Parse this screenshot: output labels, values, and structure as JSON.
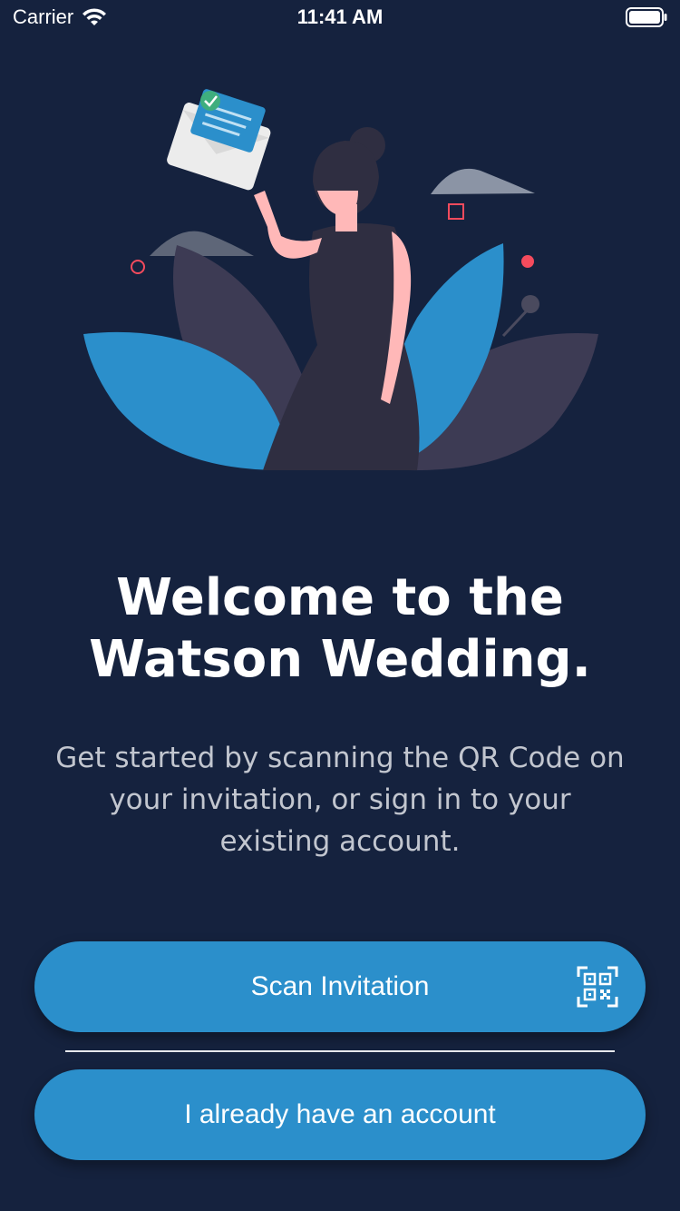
{
  "status_bar": {
    "carrier": "Carrier",
    "time": "11:41 AM",
    "wifi_icon": "wifi-icon",
    "battery_icon": "battery-icon"
  },
  "illustration": {
    "icon": "woman-holding-envelope-illustration",
    "colors": {
      "leaf_blue": "#2B8FCB",
      "leaf_dark": "#3D3B54",
      "dress": "#2F2E41",
      "skin": "#FFB8B8",
      "accent_red": "#F44B5D",
      "check_green": "#3FAE7E"
    }
  },
  "welcome": {
    "title": "Welcome to the Watson Wedding.",
    "subtitle": "Get started by scanning the QR Code on your invitation, or sign in to your existing account."
  },
  "buttons": {
    "scan_label": "Scan Invitation",
    "scan_icon": "qr-code-icon",
    "account_label": "I already have an account"
  },
  "colors": {
    "background": "#15223E",
    "button": "#2B8FCB",
    "subtitle_text": "#C2C6CF"
  }
}
